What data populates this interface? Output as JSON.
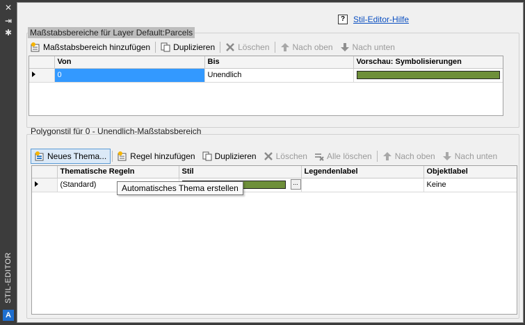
{
  "palette": {
    "title": "STIL-EDITOR",
    "close_icon": "✕",
    "autohide_icon": "⇥",
    "properties_icon": "✱",
    "logo_letter": "A"
  },
  "help": {
    "icon": "?",
    "link": "Stil-Editor-Hilfe"
  },
  "scale_ranges": {
    "title": "Maßstabsbereiche für Layer Default:Parcels",
    "toolbar": {
      "add": "Maßstabsbereich hinzufügen",
      "duplicate": "Duplizieren",
      "delete": "Löschen",
      "up": "Nach oben",
      "down": "Nach unten"
    },
    "columns": {
      "from": "Von",
      "to": "Bis",
      "preview": "Vorschau: Symbolisierungen"
    },
    "rows": [
      {
        "from": "0",
        "to": "Unendlich",
        "swatch_color": "#6e8f3a"
      }
    ]
  },
  "polygon_style": {
    "title": "Polygonstil für 0 - Unendlich-Maßstabsbereich",
    "toolbar": {
      "new_theme": "Neues Thema...",
      "add_rule": "Regel hinzufügen",
      "duplicate": "Duplizieren",
      "delete": "Löschen",
      "delete_all": "Alle löschen",
      "up": "Nach oben",
      "down": "Nach unten"
    },
    "columns": {
      "rules": "Thematische Regeln",
      "style": "Stil",
      "legend": "Legendenlabel",
      "label": "Objektlabel"
    },
    "rows": [
      {
        "rule": "(Standard)",
        "style_color": "#6e8f3a",
        "legend": "",
        "label": "Keine",
        "ellipsis": "..."
      }
    ],
    "tooltip": "Automatisches Thema erstellen"
  }
}
